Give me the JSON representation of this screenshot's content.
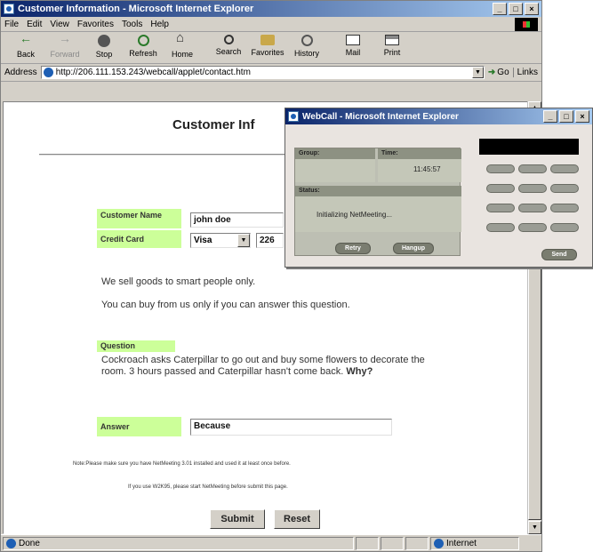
{
  "ie": {
    "title": "Customer Information - Microsoft Internet Explorer",
    "menu": [
      "File",
      "Edit",
      "View",
      "Favorites",
      "Tools",
      "Help"
    ],
    "toolbar": {
      "back": "Back",
      "forward": "Forward",
      "stop": "Stop",
      "refresh": "Refresh",
      "home": "Home",
      "search": "Search",
      "favorites": "Favorites",
      "history": "History",
      "mail": "Mail",
      "print": "Print"
    },
    "address": {
      "label": "Address",
      "url": "http://206.111.153.243/webcall/applet/contact.htm",
      "go": "Go",
      "links": "Links"
    },
    "status": {
      "text": "Done",
      "zone": "Internet"
    }
  },
  "page": {
    "title": "Customer Inf",
    "customer_name_label": "Customer Name",
    "customer_name_value": "john doe",
    "credit_card_label": "Credit Card",
    "credit_card_type": "Visa",
    "credit_card_number": "226",
    "intro1": "We sell goods to smart people only.",
    "intro2": "You can buy from us only if you can answer this question.",
    "question_label": "Question",
    "question_text": "Cockroach asks Caterpillar to go out and buy some flowers to decorate the room.  3 hours passed and Caterpillar hasn't come back.",
    "question_why": "Why?",
    "answer_label": "Answer",
    "answer_value": "Because",
    "note1": "Note:Please make sure you have NetMeeting 3.01 installed and used it at least once before.",
    "note2": "If you use W2K95, please start NetMeeting before submit this page.",
    "submit": "Submit",
    "reset": "Reset"
  },
  "webcall": {
    "title": "WebCall - Microsoft Internet Explorer",
    "group_label": "Group:",
    "time_label": "Time:",
    "time_value": "11:45:57",
    "status_label": "Status:",
    "status_value": "Initializing NetMeeting...",
    "retry": "Retry",
    "hangup": "Hangup",
    "send": "Send"
  }
}
